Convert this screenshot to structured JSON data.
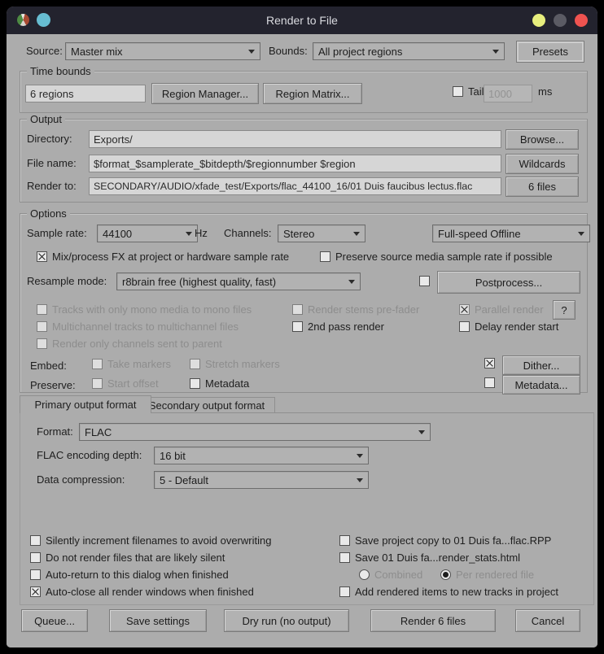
{
  "window": {
    "title": "Render to File",
    "icons": {
      "app_icon": "reaper-logo",
      "doc_icon": "cyan-dot",
      "minimize": "yellow-circle",
      "maximize": "gray-circle",
      "close": "red-circle"
    }
  },
  "top": {
    "source_label": "Source:",
    "source_value": "Master mix",
    "bounds_label": "Bounds:",
    "bounds_value": "All project regions",
    "presets_button": "Presets"
  },
  "time_bounds": {
    "group_label": "Time bounds",
    "regions_value": "6 regions",
    "region_manager_button": "Region Manager...",
    "region_matrix_button": "Region Matrix...",
    "tail_label": "Tail:",
    "tail_value": "1000",
    "tail_unit": "ms"
  },
  "output": {
    "group_label": "Output",
    "directory_label": "Directory:",
    "directory_value": "Exports/",
    "browse_button": "Browse...",
    "filename_label": "File name:",
    "filename_value": "$format_$samplerate_$bitdepth/$regionnumber $region",
    "wildcards_button": "Wildcards",
    "render_to_label": "Render to:",
    "render_to_value": "SECONDARY/AUDIO/xfade_test/Exports/flac_44100_16/01 Duis faucibus lectus.flac",
    "files_button": "6 files"
  },
  "options": {
    "group_label": "Options",
    "sample_rate_label": "Sample rate:",
    "sample_rate_value": "44100",
    "hz_label": "Hz",
    "channels_label": "Channels:",
    "channels_value": "Stereo",
    "render_speed_value": "Full-speed Offline",
    "mix_fx": "Mix/process FX at project or hardware sample rate",
    "preserve_source": "Preserve source media sample rate if possible",
    "resample_label": "Resample mode:",
    "resample_value": "r8brain free (highest quality, fast)",
    "postprocess_button": "Postprocess...",
    "mono_tracks": "Tracks with only mono media to mono files",
    "stems_prefader": "Render stems pre-fader",
    "parallel_render": "Parallel render",
    "help_button": "?",
    "multichannel": "Multichannel tracks to multichannel files",
    "second_pass": "2nd pass render",
    "delay_start": "Delay render start",
    "channels_parent": "Render only channels sent to parent",
    "embed_label": "Embed:",
    "take_markers": "Take markers",
    "stretch_markers": "Stretch markers",
    "dither_button": "Dither...",
    "preserve_label": "Preserve:",
    "start_offset": "Start offset",
    "metadata_cb": "Metadata",
    "metadata_button": "Metadata..."
  },
  "format_tabs": {
    "primary": "Primary output format",
    "secondary": "Secondary output format"
  },
  "format_panel": {
    "format_label": "Format:",
    "format_value": "FLAC",
    "depth_label": "FLAC encoding depth:",
    "depth_value": "16 bit",
    "compression_label": "Data compression:",
    "compression_value": "5 - Default"
  },
  "bottom_options": {
    "silently_increment": "Silently increment filenames to avoid overwriting",
    "no_silent": "Do not render files that are likely silent",
    "auto_return": "Auto-return to this dialog when finished",
    "auto_close": "Auto-close all render windows when finished",
    "save_copy": "Save project copy to 01 Duis fa...flac.RPP",
    "save_stats": "Save 01 Duis fa...render_stats.html",
    "combined": "Combined",
    "per_rendered": "Per rendered file",
    "add_items": "Add rendered items to new tracks in project"
  },
  "footer": {
    "queue_button": "Queue...",
    "save_settings_button": "Save settings",
    "dry_run_button": "Dry run (no output)",
    "render_button": "Render 6 files",
    "cancel_button": "Cancel"
  },
  "states": {
    "tail": false,
    "mix_fx": true,
    "preserve_source": false,
    "postprocess": false,
    "mono_tracks": false,
    "stems_prefader": false,
    "parallel_render": true,
    "multichannel": false,
    "second_pass": false,
    "delay_start": false,
    "channels_parent": false,
    "take_markers": false,
    "stretch_markers": false,
    "dither": true,
    "start_offset": false,
    "metadata_cb": false,
    "metadata_btn_cb": false,
    "silently_increment": false,
    "no_silent": false,
    "auto_return": false,
    "auto_close": true,
    "save_copy": false,
    "save_stats": false,
    "combined": false,
    "per_rendered": true,
    "add_items": false
  },
  "colors": {
    "titlebar_bg": "#23232e",
    "dialog_bg": "#acacac",
    "close_button": "#ef5350",
    "minimize_button": "#e7ee7d",
    "maximize_button": "#5b5b64",
    "doc_icon": "#67bdd1"
  }
}
